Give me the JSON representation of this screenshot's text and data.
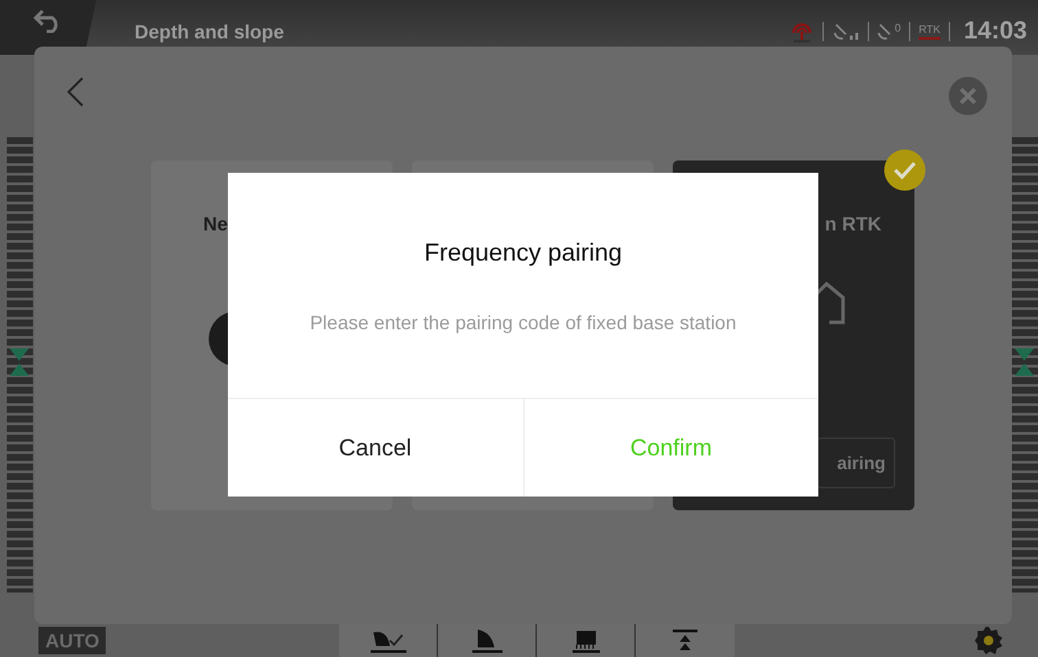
{
  "status_bar": {
    "title": "Depth and slope",
    "satellites_count": "0",
    "rtk_label": "RTK",
    "time": "14:03"
  },
  "panel": {
    "cards": [
      {
        "title": "Ne",
        "selected": false
      },
      {
        "selected": false
      },
      {
        "title": "n RTK",
        "selected": true,
        "button": "airing"
      }
    ]
  },
  "dialog": {
    "title": "Frequency pairing",
    "message": "Please enter the pairing code of fixed base station",
    "buttons": [
      {
        "label": "Cancel",
        "kind": "cancel"
      },
      {
        "label": "Confirm",
        "kind": "confirm"
      }
    ]
  },
  "bottom_bar": {
    "mode": "AUTO"
  }
}
